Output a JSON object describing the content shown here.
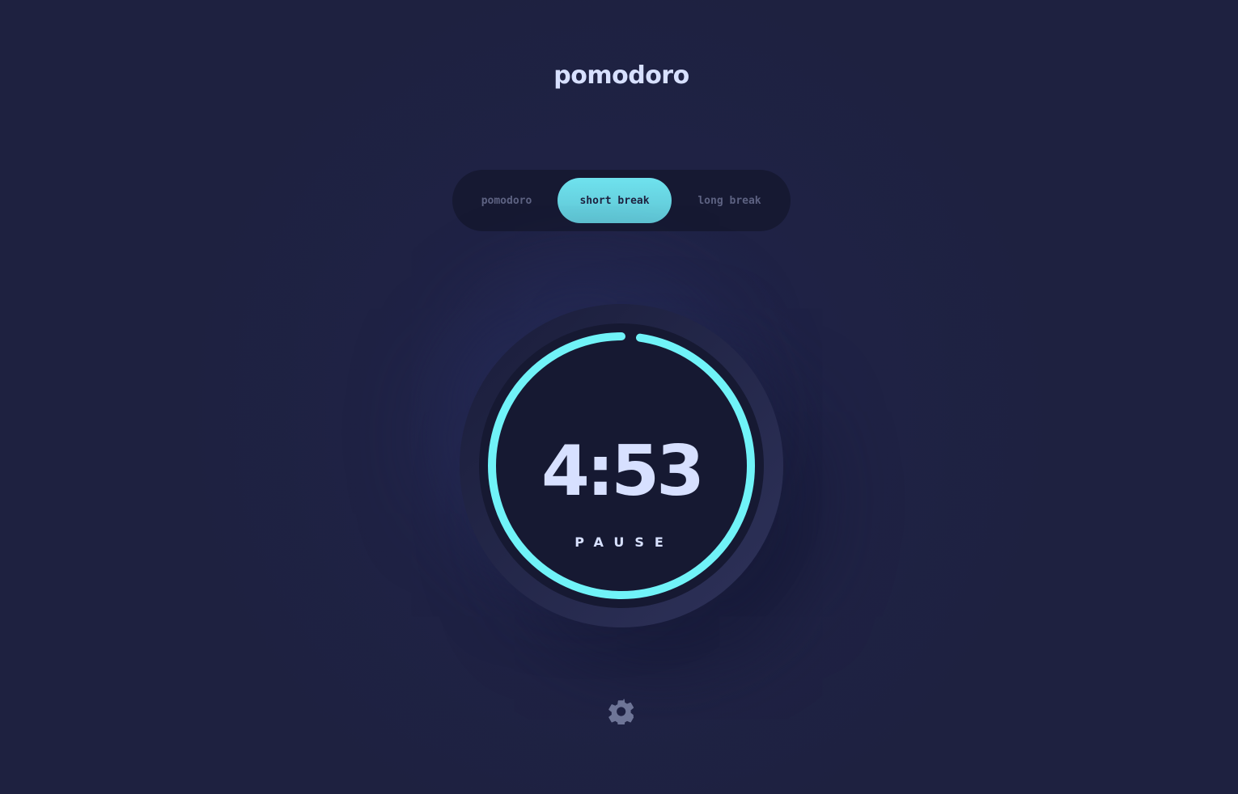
{
  "app": {
    "title": "pomodoro"
  },
  "modes": {
    "tabs": [
      {
        "label": "pomodoro"
      },
      {
        "label": "short break"
      },
      {
        "label": "long break"
      }
    ],
    "active": "short break"
  },
  "timer": {
    "time": "4:53",
    "action_label": "PAUSE",
    "progress_fraction": 0.977
  },
  "settings": {
    "icon": "gear-icon"
  },
  "colors": {
    "background": "#1e2140",
    "accent": "#70f3f8",
    "text": "#d7e0ff",
    "muted": "#5d6282",
    "panel": "#161932"
  }
}
